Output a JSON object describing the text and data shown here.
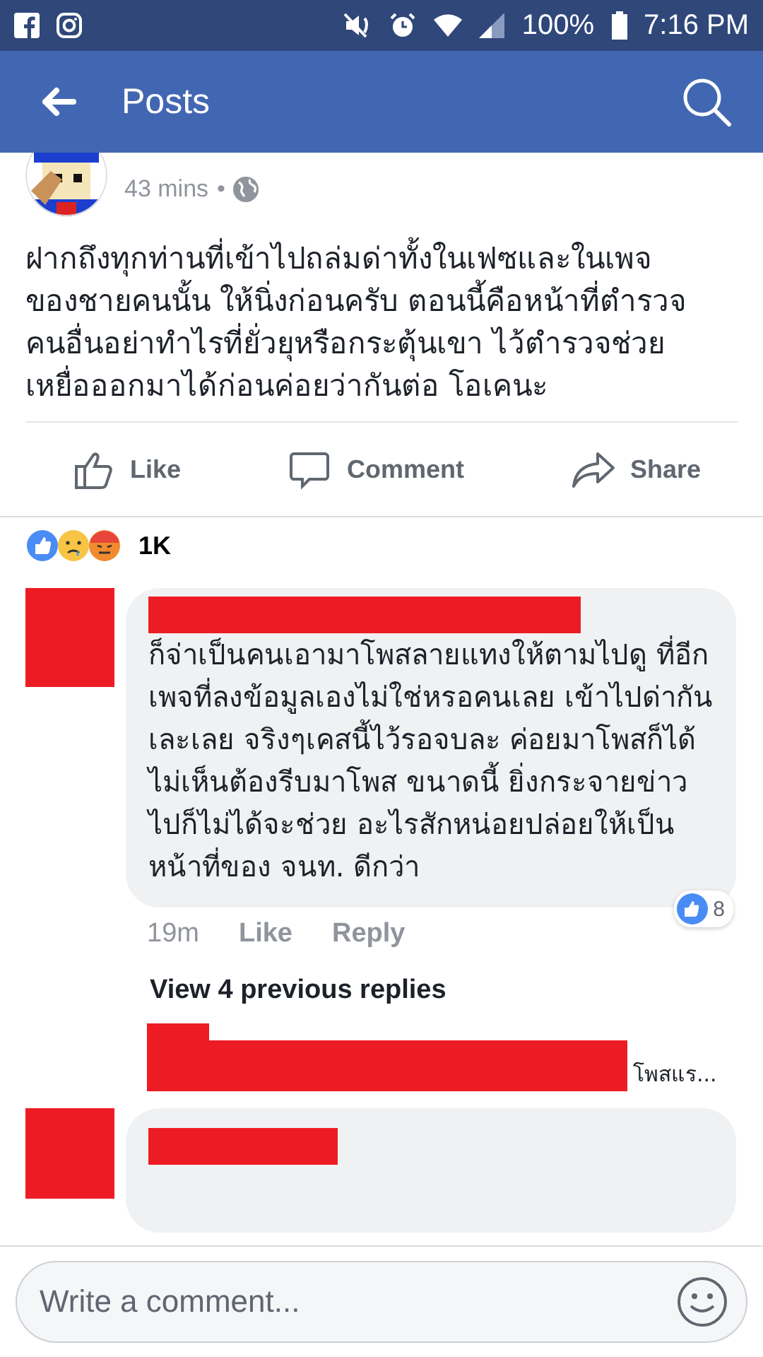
{
  "status_bar": {
    "battery": "100%",
    "time": "7:16 PM"
  },
  "header": {
    "title": "Posts"
  },
  "post": {
    "time": "43 mins",
    "separator": "•",
    "body": "ฝากถึงทุกท่านที่เข้าไปถล่มด่าทั้งในเฟซและในเพจ ของชายคนนั้น ให้นิ่งก่อนครับ ตอนนี้คือหน้าที่ตำรวจ คนอื่นอย่าทำไรที่ยั่วยุหรือกระตุ้นเขา ไว้ตำรวจช่วย เหยื่อออกมาได้ก่อนค่อยว่ากันต่อ โอเคนะ",
    "actions": [
      {
        "kind": "like",
        "label": "Like"
      },
      {
        "kind": "comment",
        "label": "Comment"
      },
      {
        "kind": "share",
        "label": "Share"
      }
    ],
    "reaction_count": "1K"
  },
  "comments": [
    {
      "kind": "full",
      "text": "ก็จ่าเป็นคนเอามาโพสลายแทงให้ตามไปดู ที่อีกเพจที่ลงข้อมูลเองไม่ใช่หรอคนเลย เข้าไปด่ากันเละเลย จริงๆเคสนี้ไว้รอจบละ ค่อยมาโพสก็ได้ไม่เห็นต้องรีบมาโพส ขนาดนี้ ยิ่งกระจายข่าวไปก็ไม่ได้จะช่วย อะไรสักหน่อยปล่อยให้เป็นหน้าที่ของ จนท. ดีกว่า",
      "time": "19m",
      "like": "Like",
      "reply": "Reply",
      "likes": "8",
      "view_replies": "View 4 previous replies",
      "reply_preview": "โพสแร..."
    },
    {
      "kind": "cut_off"
    }
  ],
  "composer": {
    "placeholder": "Write a comment..."
  }
}
